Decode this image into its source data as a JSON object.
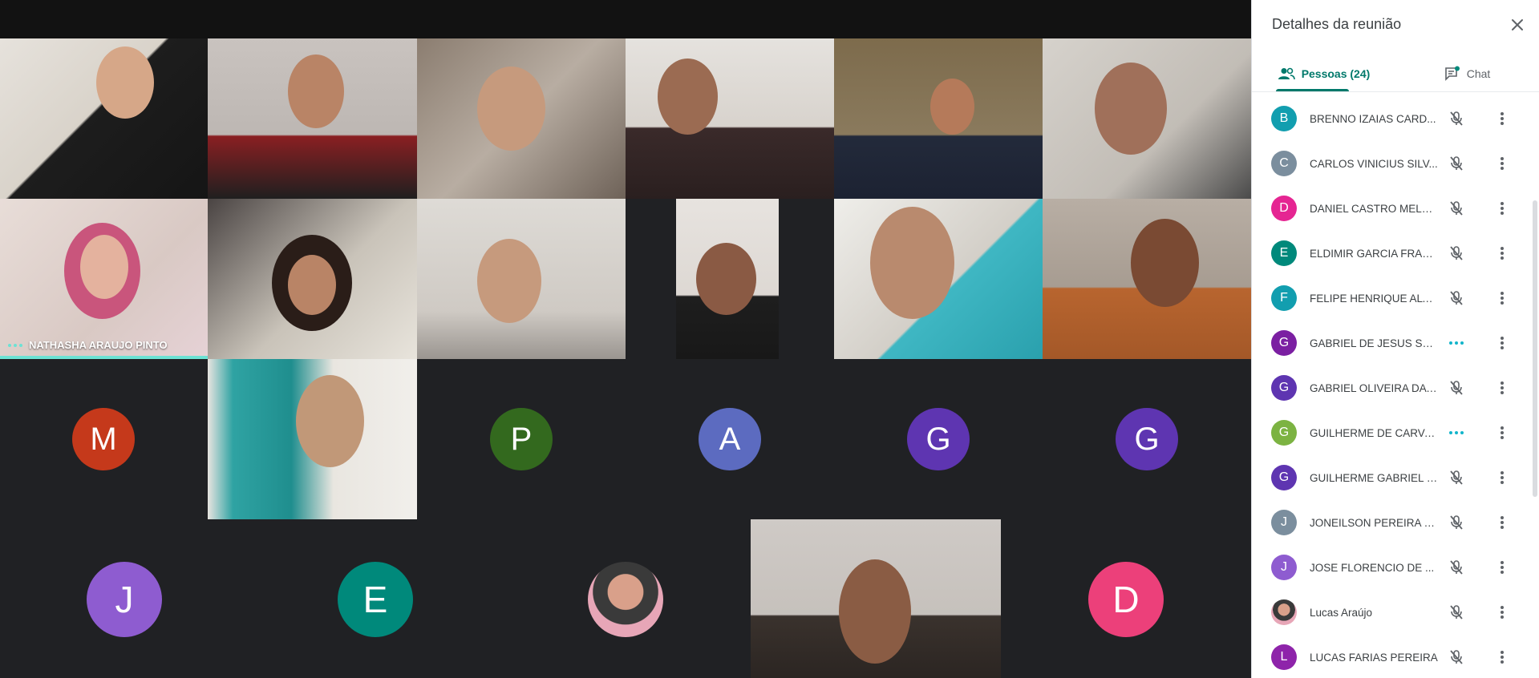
{
  "panel": {
    "title": "Detalhes da reunião",
    "tabs": [
      {
        "label": "Pessoas (24)",
        "icon": "people-icon",
        "active": true
      },
      {
        "label": "Chat",
        "icon": "chat-icon",
        "active": false
      }
    ],
    "accent": "#00796b",
    "people": [
      {
        "initial": "B",
        "name": "BRENNO IZAIAS CARD...",
        "color": "#129eaf",
        "status": "muted"
      },
      {
        "initial": "C",
        "name": "CARLOS VINICIUS SILV...",
        "color": "#7b8e9e",
        "status": "muted"
      },
      {
        "initial": "D",
        "name": "DANIEL CASTRO MELO...",
        "color": "#e52592",
        "status": "muted"
      },
      {
        "initial": "E",
        "name": "ELDIMIR GARCIA FRAN...",
        "color": "#00897b",
        "status": "muted"
      },
      {
        "initial": "F",
        "name": "FELIPE HENRIQUE ALVE...",
        "color": "#129eaf",
        "status": "muted"
      },
      {
        "initial": "G",
        "name": "GABRIEL DE JESUS SAN...",
        "color": "#7b1fa2",
        "status": "speaking"
      },
      {
        "initial": "G",
        "name": "GABRIEL OLIVEIRA DA ...",
        "color": "#5e35b1",
        "status": "muted"
      },
      {
        "initial": "G",
        "name": "GUILHERME DE CARVA...",
        "color": "#7cb342",
        "status": "speaking"
      },
      {
        "initial": "G",
        "name": "GUILHERME GABRIEL SI...",
        "color": "#5e35b1",
        "status": "muted"
      },
      {
        "initial": "J",
        "name": "JONEILSON PEREIRA F...",
        "color": "#7b8e9e",
        "status": "muted"
      },
      {
        "initial": "J",
        "name": "JOSE FLORENCIO DE ...",
        "color": "#8e5cd0",
        "status": "muted"
      },
      {
        "initial": "",
        "name": "Lucas Araújo",
        "color": "#c79a8a",
        "status": "muted",
        "photo": true
      },
      {
        "initial": "L",
        "name": "LUCAS FARIAS PEREIRA",
        "color": "#8e24aa",
        "status": "muted"
      }
    ]
  },
  "grid": {
    "speaking_color": "#6ce2d4",
    "video_tiles": [
      {
        "label": ""
      },
      {
        "label": ""
      },
      {
        "label": ""
      },
      {
        "label": ""
      },
      {
        "label": ""
      },
      {
        "label": ""
      },
      {
        "label": "NATHASHA ARAUJO PINTO",
        "speaking": true
      },
      {
        "label": ""
      },
      {
        "label": ""
      },
      {
        "label": ""
      },
      {
        "label": ""
      },
      {
        "label": ""
      },
      {
        "label": ""
      },
      {
        "label": ""
      }
    ],
    "avatar_tiles": [
      {
        "initial": "M",
        "color": "#c5391b"
      },
      {
        "initial": "P",
        "color": "#33691e"
      },
      {
        "initial": "A",
        "color": "#5c6bc0"
      },
      {
        "initial": "G",
        "color": "#5e35b1"
      },
      {
        "initial": "G",
        "color": "#5e35b1"
      },
      {
        "initial": "J",
        "color": "#8e5cd0"
      },
      {
        "initial": "E",
        "color": "#00897b"
      },
      {
        "initial": "",
        "color": "#c79a8a",
        "photo": true
      },
      {
        "initial": "D",
        "color": "#ec407a"
      }
    ]
  }
}
